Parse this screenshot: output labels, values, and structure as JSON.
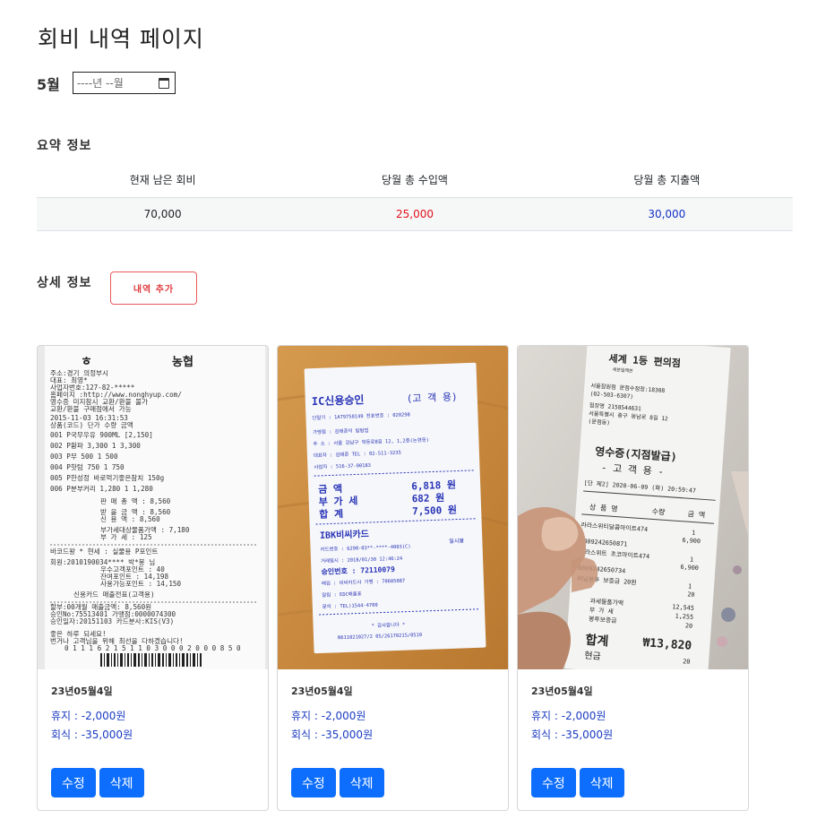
{
  "page_title": "회비 내역 페이지",
  "month": {
    "label": "5월",
    "input_placeholder": "----년 --월",
    "icon": "calendar-icon"
  },
  "summary": {
    "title": "요약 정보",
    "headers": [
      "현재 남은 회비",
      "당월 총 수입액",
      "당월 총 지출액"
    ],
    "values": [
      "70,000",
      "25,000",
      "30,000"
    ],
    "colors": {
      "income": "#e0121c",
      "expense": "#1232c8"
    }
  },
  "detail": {
    "title": "상세 정보",
    "add_button": "내역 추가"
  },
  "cards": [
    {
      "date": "23년05월4일",
      "items": [
        "휴지 : -2,000원",
        "회식 : -35,000원"
      ],
      "edit": "수정",
      "delete": "삭제",
      "receipt": {
        "store": "농협",
        "lines": [
          "주소:경기 의정부시",
          "대표: 최영*",
          "사업자번호:127-82-*****",
          "홈페이지 :http://www.nonghyup.com/",
          "영수증 미지참시 교환/환불 불가",
          "교환/환불 구매점에서 가능",
          "2015-11-03 16:31:53",
          "상품(코드)    단가   수량   금액",
          "001 P국무우유 900ML    [2,150]",
          "002 P황파       3,300  1  3,300",
          "003 P무          500  1    500",
          "004 P핫텀       750  1    750",
          "005 P한성정 바로먹기좋은참치 150g",
          "006 P분부커리   1,280  1  1,280",
          "판 매 총 액 :     8,560",
          "받 을 금 액 :     8,560",
          "신 용 액 :       8,560",
          "부가세대상물품가액 : 7,180",
          "부 가 세 :          125",
          "바코드왕 * 현세 : 실물용 P포인트",
          "회원:2010190034**** 박*봉 님",
          "우수고객포인트 :          40",
          "잔여포인트 :          14,198",
          "사용가능포인트 :      14,150",
          "신용카드 매출전표(고객용)",
          "할부:00개월   매출금액:  8,560원",
          "승인No:75513401  가맹점:0000074300",
          "승인일자:20151103  카드분사:KIS(V3)",
          "좋은 하루 되세요!",
          "번거나 고객님을 위해 최선을 다하겠습니다!",
          "0 1 1 1 6 2 1 5 1 1 0 3 0 0 0 2 0 0 0 8 5 0"
        ]
      }
    },
    {
      "date": "23년05월4일",
      "items": [
        "휴지 : -2,000원",
        "회식 : -35,000원"
      ],
      "edit": "수정",
      "delete": "삭제",
      "receipt": {
        "header": "IC신용승인",
        "header_right": "(고 객 용)",
        "lines": [
          "단말기 : 1A79750149   전표번호 : 020298",
          "가맹점 : 김태준의 탐탐집",
          "주 소 : 서울 강남구 학동로8길 12, 1,2층(논현동)",
          "대표자 : 김태준      TEL : 02-511-3235",
          "사업자 : 516-37-00183"
        ],
        "amounts": [
          [
            "금   액",
            "6,818 원"
          ],
          [
            "부 가 세",
            "682 원"
          ],
          [
            "합   계",
            "7,500 원"
          ]
        ],
        "card_name": "IBK비씨카드",
        "card_type": "일시불",
        "card_lines": [
          "카드번호 : 6290-03**-****-4003(C)",
          "거래일시 : 2018/01/30 12:46:24",
          "승인번호 : 72110079",
          "매입 : 비씨카드사    가맹 : 70605087",
          "알림 : EDC매출표",
          "문의 : TEL)1544-4700"
        ],
        "footer": [
          "* 감사합니다 *",
          "N611021027/2 05/26170215/0510"
        ]
      }
    },
    {
      "date": "23년05월4일",
      "items": [
        "휴지 : -2,000원",
        "회식 : -35,000원"
      ],
      "edit": "수정",
      "delete": "삭제",
      "receipt": {
        "brand": "세계 1등 편의점",
        "brand_sub": "세븐일레븐",
        "lines": [
          "서울잠원점   문점수점정:18308",
          "(02-503-6307)",
          "점장명    2158544631",
          "서울특별시 중구 동남로 8길 12",
          "(문점동)"
        ],
        "receipt_title": "영수증(지점발급)",
        "receipt_sub": "- 고 객 용 -",
        "datetime": "[단 제2] 2020-06-09 (화) 20:59:47",
        "table_header": [
          "상 품 명",
          "수량",
          "금 액"
        ],
        "rows": [
          [
            "라라스위티달콤마이트474",
            "1",
            "6,900"
          ],
          [
            "8809242650871",
            "",
            ""
          ],
          [
            "라라스위트 초코마이트474",
            "1",
            "6,900"
          ],
          [
            "8809242650734",
            "",
            ""
          ],
          [
            "비닐봉투 보증금 20원",
            "1",
            "20"
          ]
        ],
        "totals": [
          [
            "과세물품가액",
            "12,545"
          ],
          [
            "부 가 세",
            "1,255"
          ],
          [
            "봉투보증금",
            "20"
          ]
        ],
        "grand_label": "합계",
        "grand_total": "₩13,820",
        "cash_label": "현금",
        "cash_value": "20"
      }
    }
  ]
}
